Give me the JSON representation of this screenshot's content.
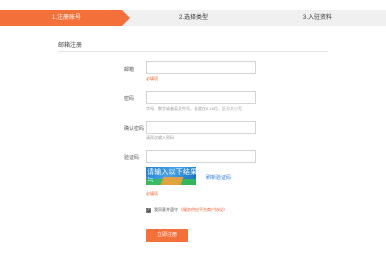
{
  "steps": [
    {
      "label": "1.注册账号",
      "active": true
    },
    {
      "label": "2.选择类型",
      "active": false
    },
    {
      "label": "3.入驻资料",
      "active": false
    }
  ],
  "colors": {
    "accent": "#f3703a",
    "error": "#e85a2a",
    "link": "#2b7bd8"
  },
  "section": {
    "title": "邮箱注册"
  },
  "form": {
    "email": {
      "label": "邮箱",
      "value": "",
      "hint": "必填项"
    },
    "password": {
      "label": "密码",
      "value": "",
      "hint": "字母、数字或者英文符号，长度在6-16位，区分大小写"
    },
    "confirm": {
      "label": "确认密码",
      "value": "",
      "hint": "请再次输入密码"
    },
    "captcha": {
      "label": "验证码",
      "value": "",
      "image_text": "请输入以下结果",
      "image_glyph": "≒",
      "refresh": "刷新验证码",
      "hint": "必填项"
    }
  },
  "agree": {
    "checked": true,
    "text": "我同意并遵守",
    "link": "《服务供应平台商户协议》"
  },
  "submit": {
    "label": "立即注册"
  }
}
